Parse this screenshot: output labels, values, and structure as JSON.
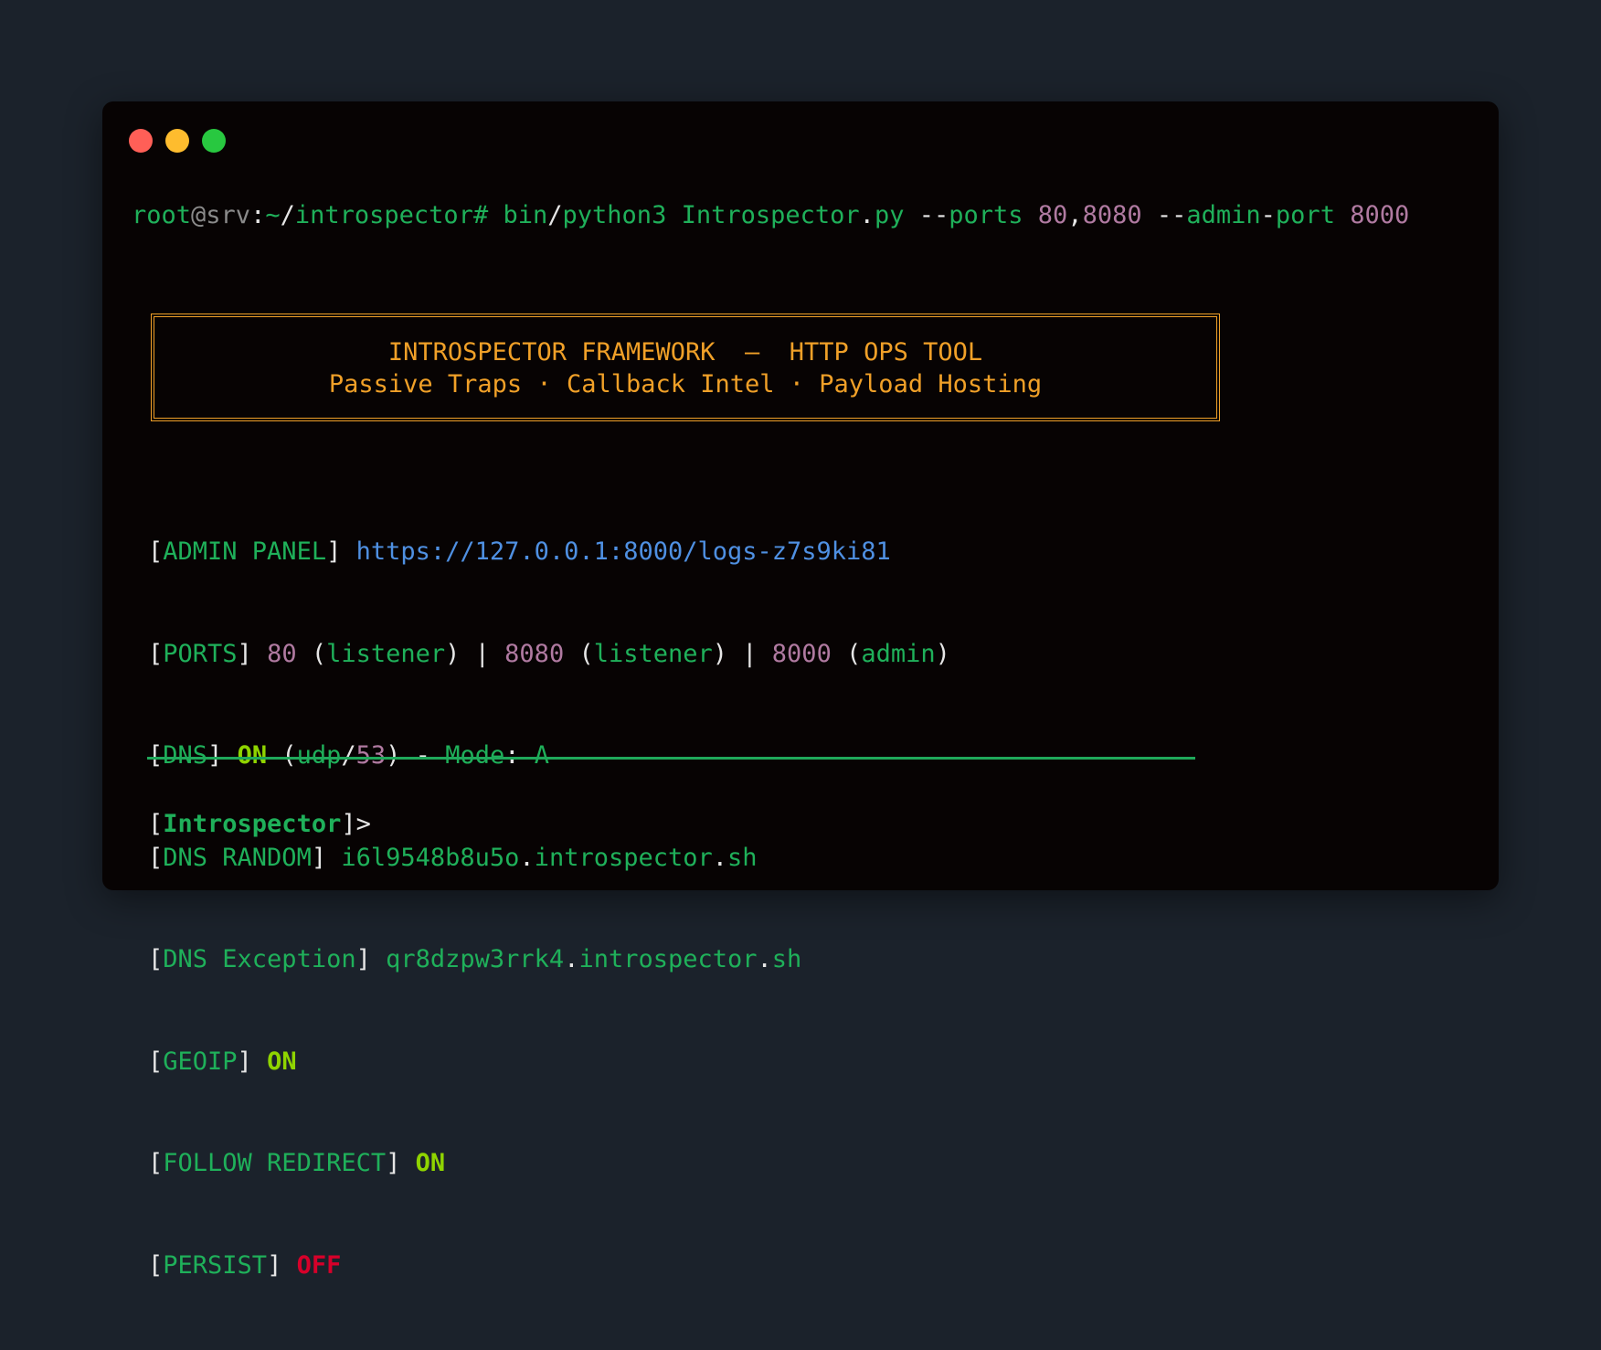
{
  "window": {
    "traffic_lights": [
      "close",
      "minimize",
      "maximize"
    ]
  },
  "command": {
    "user": "root",
    "at": "@",
    "host": "srv",
    "colon": ":",
    "tilde": "~",
    "slash1": "/",
    "dir": "introspector",
    "hash": "#",
    "bin": "bin",
    "slash2": "/",
    "python": "python3",
    "script": "Introspector",
    "dot": ".",
    "ext": "py",
    "dash1": "--",
    "flag1": "ports",
    "port_a": "80",
    "comma": ",",
    "port_b": "8080",
    "dash2": "--",
    "flag2a": "admin",
    "hyphen": "-",
    "flag2b": "port",
    "admin_port": "8000"
  },
  "banner": {
    "line1": "INTROSPECTOR FRAMEWORK  —  HTTP OPS TOOL",
    "line2": "Passive Traps · Callback Intel · Payload Hosting"
  },
  "info": {
    "admin_panel": {
      "label": "ADMIN PANEL",
      "value": "https://127.0.0.1:8000/logs-z7s9ki81"
    },
    "ports": {
      "label": "PORTS",
      "p1": "80",
      "p1_role": "listener",
      "p2": "8080",
      "p2_role": "listener",
      "p3": "8000",
      "p3_role": "admin"
    },
    "dns": {
      "label": "DNS",
      "state": "ON",
      "proto": "udp",
      "port": "53",
      "mode_label": "Mode",
      "mode": "A"
    },
    "dns_random": {
      "label": "DNS RANDOM",
      "host": "i6l9548b8u5o",
      "domain": "introspector",
      "tld": "sh"
    },
    "dns_exception": {
      "label": "DNS Exception",
      "host": "qr8dzpw3rrk4",
      "domain": "introspector",
      "tld": "sh"
    },
    "geoip": {
      "label": "GEOIP",
      "state": "ON"
    },
    "follow_redirect": {
      "label": "FOLLOW REDIRECT",
      "state": "ON"
    },
    "persist": {
      "label": "PERSIST",
      "state": "OFF"
    }
  },
  "prompt": {
    "name": "Introspector",
    "symbol": ">"
  },
  "colors": {
    "background": "#1b222b",
    "terminal": "#070303",
    "green": "#1fb05a",
    "purple": "#b07aa1",
    "blue": "#4f90e2",
    "lime": "#8fd400",
    "red": "#d6002a",
    "orange": "#f0a028"
  }
}
